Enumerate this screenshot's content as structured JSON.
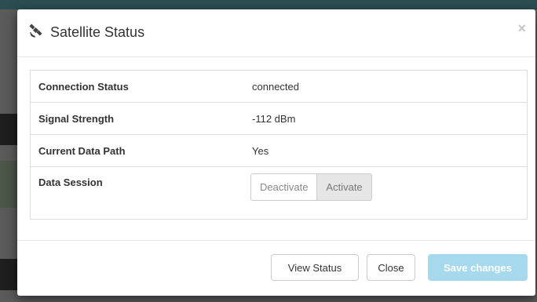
{
  "modal": {
    "title": "Satellite Status",
    "icon": "satellite-icon",
    "close_symbol": "×"
  },
  "status_table": {
    "rows": [
      {
        "label": "Connection Status",
        "value": "connected"
      },
      {
        "label": "Signal Strength",
        "value": "-112 dBm"
      },
      {
        "label": "Current Data Path",
        "value": "Yes"
      }
    ],
    "session": {
      "label": "Data Session",
      "deactivate_label": "Deactivate",
      "activate_label": "Activate"
    }
  },
  "footer": {
    "view_status_label": "View Status",
    "close_label": "Close",
    "save_label": "Save changes"
  },
  "colors": {
    "primary_disabled": "#a6d9ee",
    "backdrop": "#5a5a5a"
  }
}
